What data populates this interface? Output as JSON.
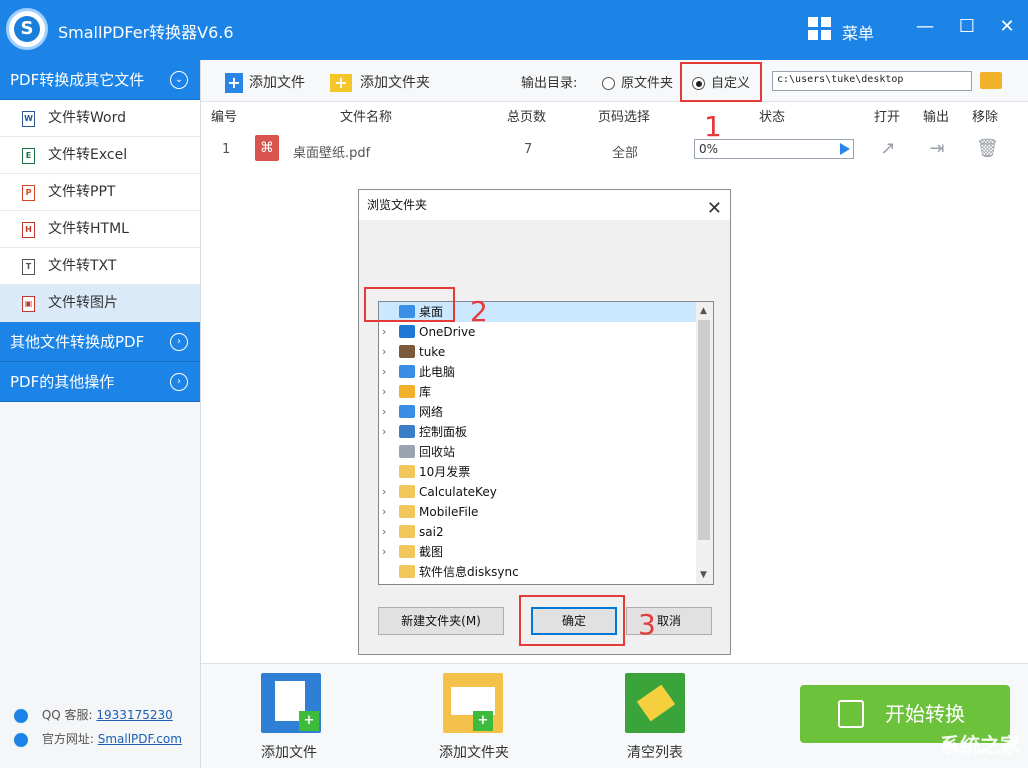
{
  "app": {
    "title": "SmallPDFer转换器V6.6",
    "logo_letter": "S",
    "menu_label": "菜单"
  },
  "window_controls": {
    "minimize": "—",
    "maximize": "☐",
    "close": "✕"
  },
  "sidebar": {
    "section1": "PDF转换成其它文件",
    "items": [
      {
        "label": "文件转Word",
        "ico": "W",
        "color": "#2b5797"
      },
      {
        "label": "文件转Excel",
        "ico": "E",
        "color": "#1e7145"
      },
      {
        "label": "文件转PPT",
        "ico": "P",
        "color": "#d24726"
      },
      {
        "label": "文件转HTML",
        "ico": "H",
        "color": "#c0392b"
      },
      {
        "label": "文件转TXT",
        "ico": "T",
        "color": "#555555"
      },
      {
        "label": "文件转图片",
        "ico": "▣",
        "color": "#c0392b"
      }
    ],
    "section2": "其他文件转换成PDF",
    "section3": "PDF的其他操作",
    "qq_label": "QQ 客服:",
    "qq_value": "1933175230",
    "site_label": "官方网址:",
    "site_value": "SmallPDF.com"
  },
  "toolbar": {
    "add_file": "添加文件",
    "add_folder": "添加文件夹",
    "output_label": "输出目录:",
    "option_original": "原文件夹",
    "option_custom": "自定义",
    "path_value": "c:\\users\\tuke\\desktop"
  },
  "table": {
    "headers": [
      "编号",
      "文件名称",
      "总页数",
      "页码选择",
      "状态",
      "打开",
      "输出",
      "移除"
    ],
    "row": {
      "index": "1",
      "name": "桌面壁纸.pdf",
      "pages": "7",
      "range": "全部",
      "progress": "0%"
    }
  },
  "dialog": {
    "title": "浏览文件夹",
    "close": "✕",
    "tree": [
      {
        "label": "桌面",
        "chev": "",
        "icon": "#3a8ee6",
        "selected": true
      },
      {
        "label": "OneDrive",
        "chev": "›",
        "icon": "#1e78d6"
      },
      {
        "label": "tuke",
        "chev": "›",
        "icon": "#7a5a3a"
      },
      {
        "label": "此电脑",
        "chev": "›",
        "icon": "#3a8ee6"
      },
      {
        "label": "库",
        "chev": "›",
        "icon": "#f1b12b"
      },
      {
        "label": "网络",
        "chev": "›",
        "icon": "#3a8ee6"
      },
      {
        "label": "控制面板",
        "chev": "›",
        "icon": "#3a7ec6"
      },
      {
        "label": "回收站",
        "chev": "",
        "icon": "#9aa4b0"
      },
      {
        "label": "10月发票",
        "chev": "",
        "icon": "#f1c65a"
      },
      {
        "label": "CalculateKey",
        "chev": "›",
        "icon": "#f1c65a"
      },
      {
        "label": "MobileFile",
        "chev": "›",
        "icon": "#f1c65a"
      },
      {
        "label": "sai2",
        "chev": "›",
        "icon": "#f1c65a"
      },
      {
        "label": "截图",
        "chev": "›",
        "icon": "#f1c65a"
      },
      {
        "label": "软件信息disksync",
        "chev": "",
        "icon": "#f1c65a"
      }
    ],
    "new_folder_btn": "新建文件夹(M)",
    "ok_btn": "确定",
    "cancel_btn": "取消"
  },
  "annotations": {
    "n1": "1",
    "n2": "2",
    "n3": "3",
    "color": "#e53a3a"
  },
  "bottom": {
    "add_file": "添加文件",
    "add_folder": "添加文件夹",
    "clear_list": "清空列表",
    "start": "开始转换",
    "watermark": "系统之家"
  }
}
